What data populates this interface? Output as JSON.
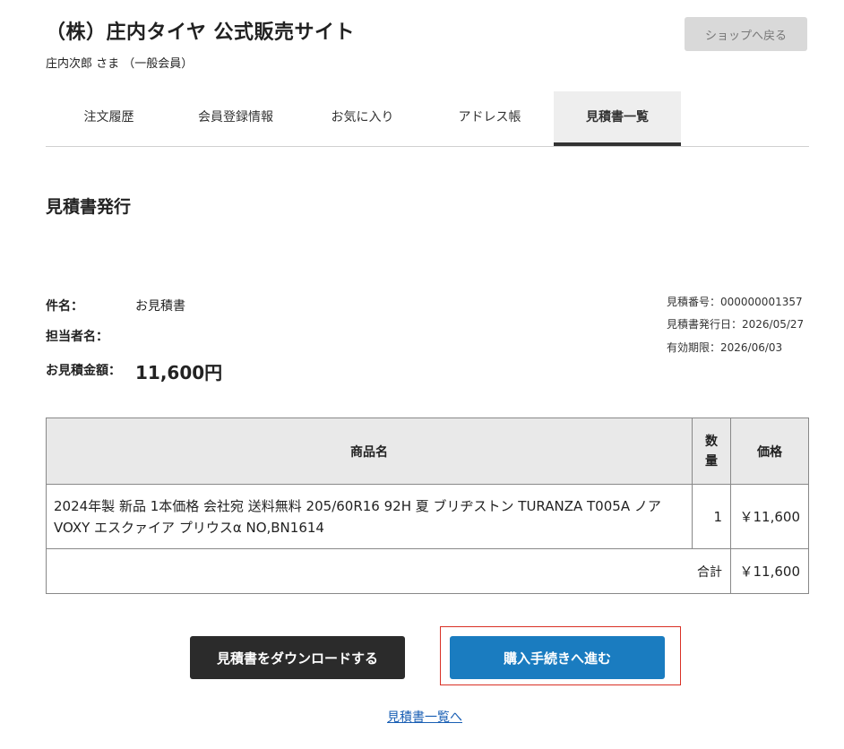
{
  "header": {
    "shop_title": "（株）庄内タイヤ 公式販売サイト",
    "user_line": "庄内次郎 さま （一般会員）",
    "back_button": "ショップへ戻る"
  },
  "tabs": [
    {
      "label": "注文履歴",
      "active": false
    },
    {
      "label": "会員登録情報",
      "active": false
    },
    {
      "label": "お気に入り",
      "active": false
    },
    {
      "label": "アドレス帳",
      "active": false
    },
    {
      "label": "見積書一覧",
      "active": true
    }
  ],
  "quote": {
    "section_title": "見積書発行",
    "subject_label": "件名：",
    "subject_value": "お見積書",
    "person_label": "担当者名：",
    "amount_label": "お見積金額：",
    "amount_value": "11,600円",
    "number": "見積番号：000000001357",
    "issue_date": "見積書発行日：2026/05/27",
    "expiry": "有効期限：2026/06/03"
  },
  "table": {
    "headers": {
      "product": "商品名",
      "qty_line1": "数",
      "qty_line2": "量",
      "price": "価格"
    },
    "rows": [
      {
        "product": "2024年製 新品 1本価格 会社宛 送料無料 205/60R16 92H 夏 ブリヂストン TURANZA T005A ノア VOXY エスクァイア プリウスα NO,BN1614",
        "qty": "1",
        "price": "￥11,600"
      }
    ],
    "total_label": "合計",
    "total_value": "￥11,600"
  },
  "actions": {
    "download": "見積書をダウンロードする",
    "purchase": "購入手続きへ進む",
    "back_to_list": "見積書一覧へ"
  },
  "colors": {
    "accent": "#1a7cc0",
    "dark_button": "#2b2b2b",
    "highlight": "#d93025"
  }
}
